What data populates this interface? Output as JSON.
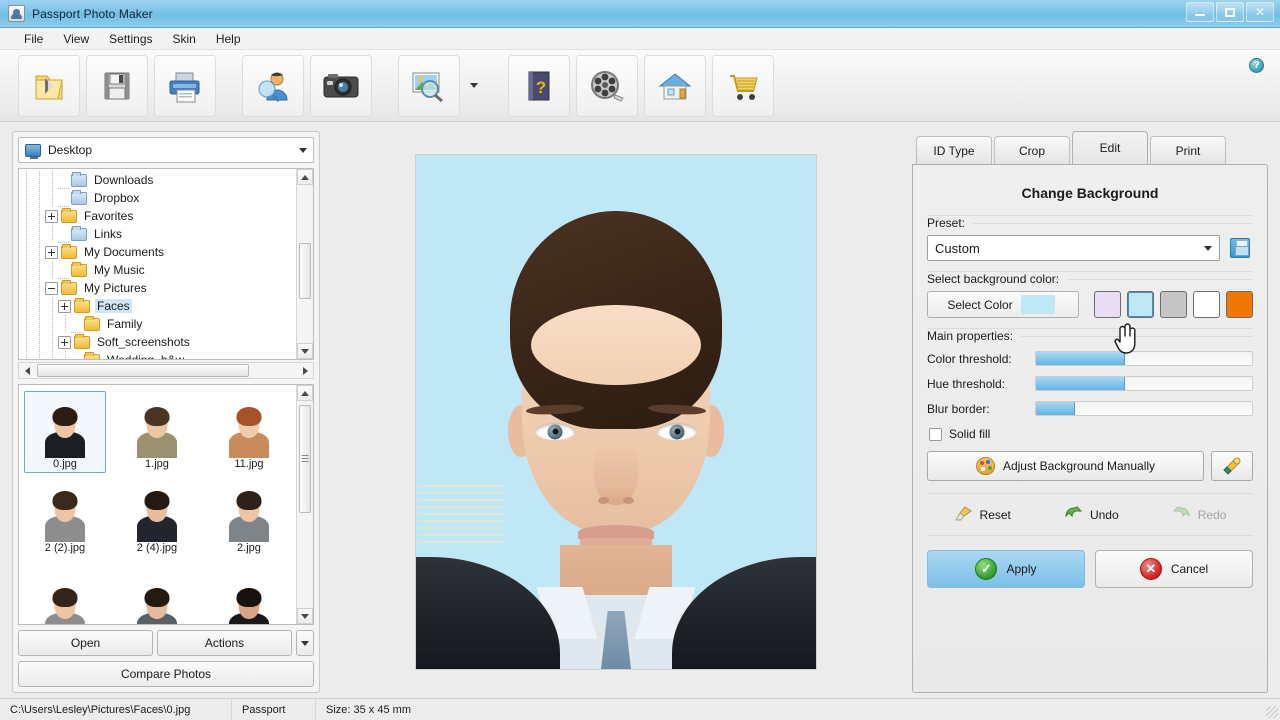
{
  "window": {
    "title": "Passport Photo Maker",
    "app_icon": "app-icon",
    "minimize": "–",
    "maximize": "□",
    "close": "✕"
  },
  "menu": {
    "items": [
      "File",
      "View",
      "Settings",
      "Skin",
      "Help"
    ]
  },
  "toolbar": {
    "buttons": [
      {
        "name": "open-photo",
        "icon": "open-folder-icon"
      },
      {
        "name": "save",
        "icon": "save-diskette-icon"
      },
      {
        "name": "print",
        "icon": "printer-icon"
      },
      {
        "name": "compare-faces",
        "icon": "person-search-icon"
      },
      {
        "name": "capture-from-camera",
        "icon": "camera-icon"
      },
      {
        "name": "preview-photo",
        "icon": "photo-magnifier-icon"
      },
      {
        "name": "help",
        "icon": "help-book-icon"
      },
      {
        "name": "video-tutorial",
        "icon": "film-reel-icon"
      },
      {
        "name": "home-page",
        "icon": "home-icon"
      },
      {
        "name": "buy-now",
        "icon": "shopping-cart-icon"
      }
    ],
    "info_badge": "?"
  },
  "explorer": {
    "path_combo": {
      "label": "Desktop",
      "icon": "desktop-icon"
    },
    "tree": [
      {
        "label": "Downloads",
        "indent": 3,
        "expander": "none",
        "folder": "blue",
        "selected": false
      },
      {
        "label": "Dropbox",
        "indent": 3,
        "expander": "none",
        "folder": "blue",
        "selected": false
      },
      {
        "label": "Favorites",
        "indent": 2,
        "expander": "plus",
        "folder": "yellow",
        "selected": false
      },
      {
        "label": "Links",
        "indent": 3,
        "expander": "none",
        "folder": "blue",
        "selected": false
      },
      {
        "label": "My Documents",
        "indent": 2,
        "expander": "plus",
        "folder": "yellow",
        "selected": false
      },
      {
        "label": "My Music",
        "indent": 3,
        "expander": "none",
        "folder": "yellow",
        "selected": false
      },
      {
        "label": "My Pictures",
        "indent": 2,
        "expander": "minus",
        "folder": "yellow",
        "selected": false
      },
      {
        "label": "Faces",
        "indent": 3,
        "expander": "plus",
        "folder": "yellow",
        "selected": true
      },
      {
        "label": "Family",
        "indent": 4,
        "expander": "none",
        "folder": "yellow",
        "selected": false
      },
      {
        "label": "Soft_screenshots",
        "indent": 3,
        "expander": "plus",
        "folder": "yellow",
        "selected": false
      },
      {
        "label": "Wedding_b&w",
        "indent": 4,
        "expander": "none",
        "folder": "yellow",
        "selected": false
      }
    ],
    "thumbnails": [
      {
        "caption": "0.jpg",
        "selected": true,
        "hair": "#2c1c11",
        "skin": "#eec5a4",
        "body": "#1b1e22"
      },
      {
        "caption": "1.jpg",
        "selected": false,
        "hair": "#4a3422",
        "skin": "#eec5a4",
        "body": "#9b9170"
      },
      {
        "caption": "11.jpg",
        "selected": false,
        "hair": "#a6522a",
        "skin": "#f0cbab",
        "body": "#c98a5c"
      },
      {
        "caption": "2 (2).jpg",
        "selected": false,
        "hair": "#3a2a1c",
        "skin": "#eec5a4",
        "body": "#8d8d8d"
      },
      {
        "caption": "2 (4).jpg",
        "selected": false,
        "hair": "#241a12",
        "skin": "#e8bd9b",
        "body": "#22252b"
      },
      {
        "caption": "2.jpg",
        "selected": false,
        "hair": "#2e2119",
        "skin": "#eec5a4",
        "body": "#7f8489"
      },
      {
        "caption": "",
        "selected": false,
        "hair": "#33241a",
        "skin": "#eec5a4",
        "body": "#8d8d8d"
      },
      {
        "caption": "",
        "selected": false,
        "hair": "#241a12",
        "skin": "#e4bb9c",
        "body": "#5b5f66"
      },
      {
        "caption": "",
        "selected": false,
        "hair": "#191310",
        "skin": "#d9a484",
        "body": "#17191d"
      }
    ],
    "buttons": {
      "open": "Open",
      "actions": "Actions",
      "compare": "Compare Photos"
    }
  },
  "right": {
    "tabs": [
      {
        "label": "ID Type",
        "active": false
      },
      {
        "label": "Crop",
        "active": false
      },
      {
        "label": "Edit",
        "active": true
      },
      {
        "label": "Print",
        "active": false
      }
    ],
    "panel_title": "Change Background",
    "preset": {
      "label": "Preset:",
      "value": "Custom",
      "save_icon": "save-preset-icon"
    },
    "background_color": {
      "label": "Select background color:",
      "select_button": "Select Color",
      "current_color": "#bfe7f6",
      "swatches": [
        {
          "name": "swatch-lavender",
          "color": "#e9dff5",
          "selected": false
        },
        {
          "name": "swatch-light-blue",
          "color": "#bfe7f6",
          "selected": true
        },
        {
          "name": "swatch-gray",
          "color": "#c6c6c6",
          "selected": false
        },
        {
          "name": "swatch-white",
          "color": "#ffffff",
          "selected": false
        },
        {
          "name": "swatch-orange",
          "color": "#f07800",
          "selected": false
        }
      ]
    },
    "main_properties": {
      "label": "Main properties:",
      "sliders": [
        {
          "name": "color-threshold",
          "label": "Color threshold:",
          "percent": 41
        },
        {
          "name": "hue-threshold",
          "label": "Hue threshold:",
          "percent": 41
        },
        {
          "name": "blur-border",
          "label": "Blur border:",
          "percent": 18
        }
      ],
      "solid_fill": {
        "label": "Solid fill",
        "checked": false
      }
    },
    "adjust": {
      "button_label": "Adjust Background Manually",
      "palette_icon": "palette-icon",
      "eyedropper_icon": "eyedropper-icon"
    },
    "history": [
      {
        "name": "reset",
        "label": "Reset",
        "icon": "brush-icon",
        "disabled": false
      },
      {
        "name": "undo",
        "label": "Undo",
        "icon": "undo-arrow-icon",
        "disabled": false
      },
      {
        "name": "redo",
        "label": "Redo",
        "icon": "redo-arrow-icon",
        "disabled": true
      }
    ],
    "actions": {
      "apply": {
        "label": "Apply",
        "icon": "check-circle-icon"
      },
      "cancel": {
        "label": "Cancel",
        "icon": "cancel-circle-icon"
      }
    }
  },
  "statusbar": {
    "file_path": "C:\\Users\\Lesley\\Pictures\\Faces\\0.jpg",
    "doc_type": "Passport",
    "size": "Size: 35 x 45 mm"
  },
  "preview": {
    "background_color": "#bfe7f6"
  }
}
